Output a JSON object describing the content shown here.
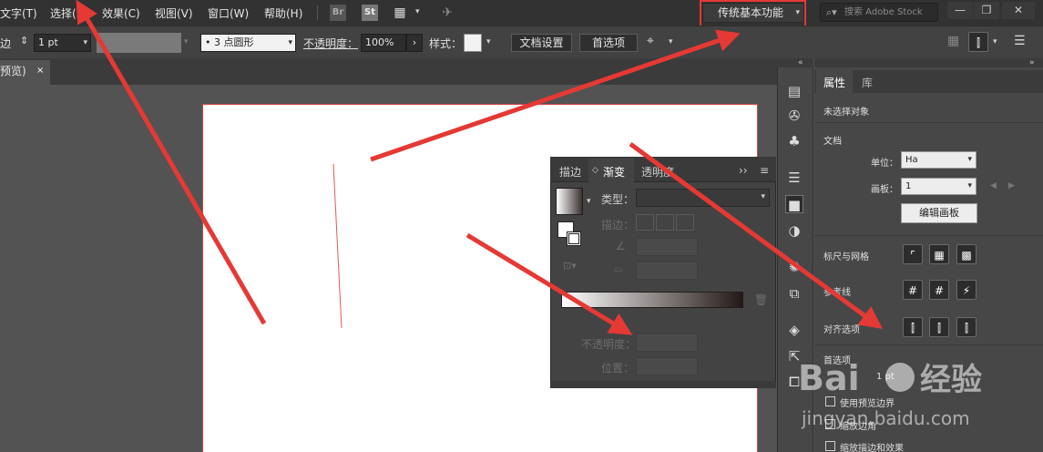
{
  "menu": {
    "items": [
      "文字(T)",
      "选择(S)",
      "效果(C)",
      "视图(V)",
      "窗口(W)",
      "帮助(H)"
    ],
    "br_label": "Br",
    "st_label": "St"
  },
  "workspace": {
    "label": "传统基本功能"
  },
  "search": {
    "placeholder": "搜索 Adobe Stock"
  },
  "window_buttons": {
    "minimize": "—",
    "restore": "❐",
    "close": "✕"
  },
  "control_bar": {
    "stroke_label_fragment": "边",
    "stroke_weight": "1 pt",
    "brush_value": "• 3 点圆形",
    "opacity_label": "不透明度：",
    "opacity_value": "100%",
    "style_label": "样式：",
    "doc_setup_button": "文档设置",
    "prefs_button": "首选项"
  },
  "document_tab": {
    "label": "预览)",
    "close": "×"
  },
  "gradient_panel": {
    "tabs": [
      "描边",
      "渐变",
      "透明度"
    ],
    "active_tab": "渐变",
    "type_label": "类型：",
    "stroke_label": "描边：",
    "opacity_label": "不透明度：",
    "location_label": "位置：",
    "menu_icon": "≡",
    "collapse": "››"
  },
  "properties_panel": {
    "tabs": [
      "属性",
      "库"
    ],
    "no_selection": "未选择对象",
    "document_header": "文档",
    "unit_label": "单位：",
    "unit_value": "Ha",
    "artboard_label": "画板：",
    "artboard_value": "1",
    "edit_artboards_button": "编辑画板",
    "rulers_grids_label": "标尺与网格",
    "guides_label": "参考线",
    "align_options_label": "对齐选项",
    "preferences_header": "首选项",
    "keyboard_increment_value": "1 pt",
    "checkboxes": [
      "使用预览边界",
      "缩放边角",
      "缩放描边和效果"
    ]
  },
  "watermark": {
    "brand_left": "Bai",
    "brand_right": "经验",
    "url": "jingyan.baidu.com"
  },
  "colors": {
    "annotation_red": "#e53935",
    "ui_dark": "#323232",
    "panel": "#474747"
  }
}
